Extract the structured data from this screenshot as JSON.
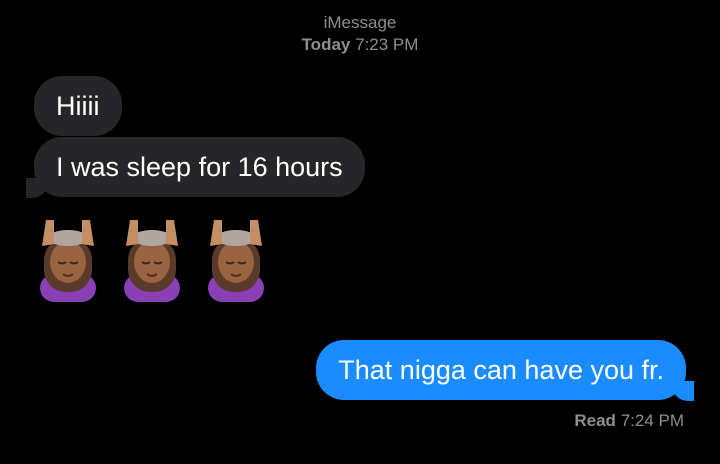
{
  "header": {
    "service": "iMessage",
    "day": "Today",
    "time": "7:23 PM"
  },
  "messages": [
    {
      "direction": "incoming",
      "text": "Hiiii"
    },
    {
      "direction": "incoming",
      "text": "I was sleep for 16 hours"
    },
    {
      "direction": "incoming",
      "emoji": "person-getting-massage",
      "count": 3
    },
    {
      "direction": "outgoing",
      "text": "That nigga can have you fr."
    }
  ],
  "receipt": {
    "label": "Read",
    "time": "7:24 PM"
  },
  "colors": {
    "background": "#000000",
    "incoming_bubble": "#262628",
    "outgoing_bubble": "#1a8cff",
    "meta_text": "#8e8e93"
  }
}
